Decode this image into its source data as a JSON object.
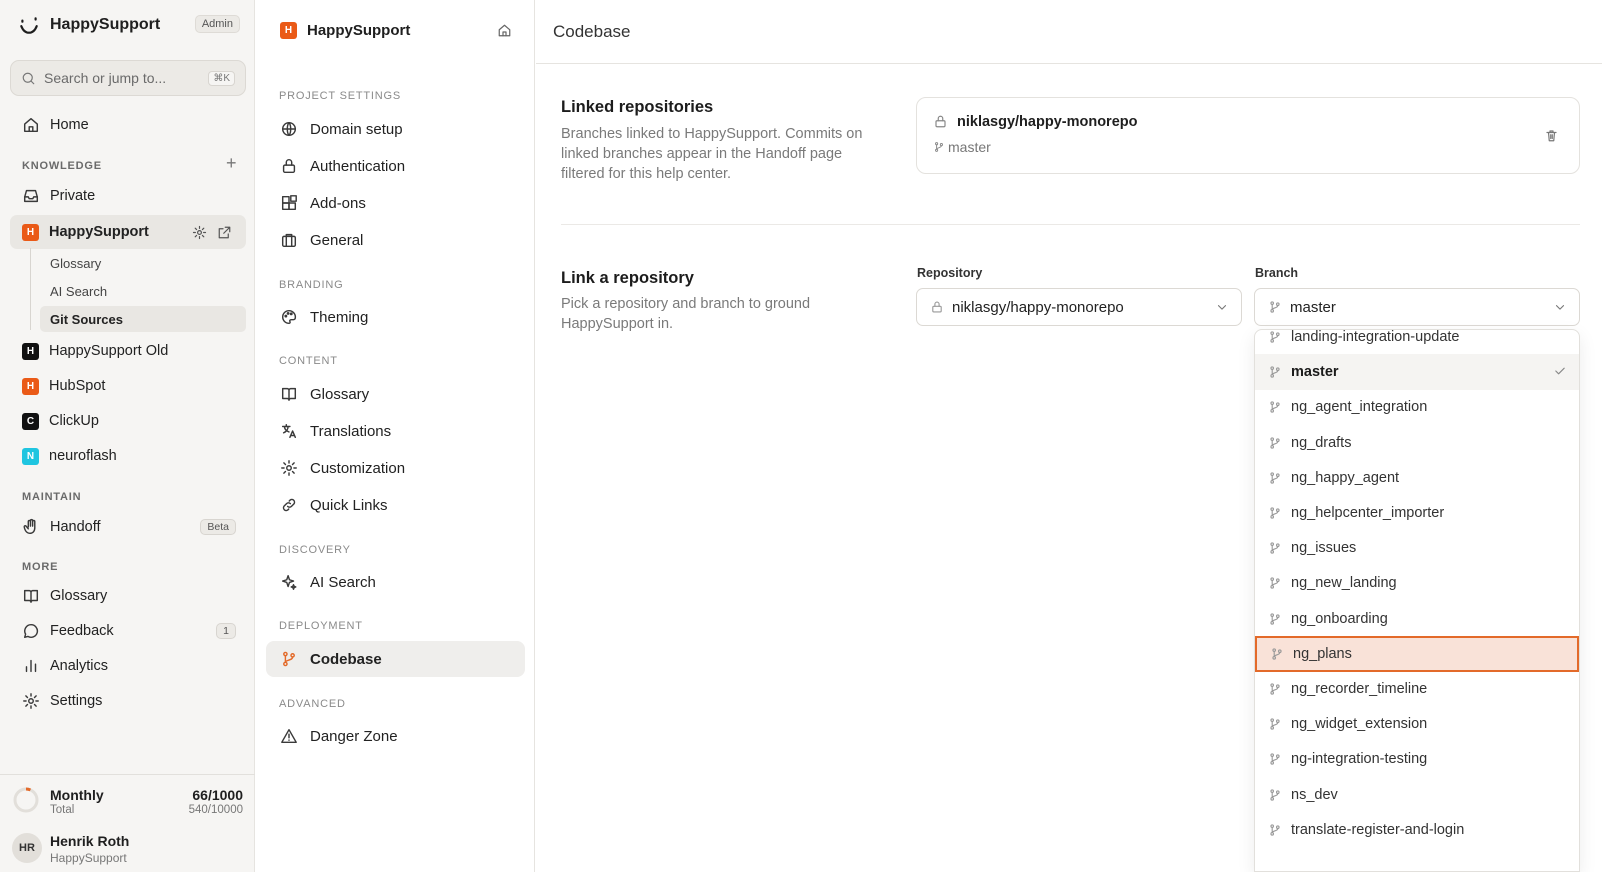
{
  "sidebar": {
    "brand": "HappySupport",
    "role_badge": "Admin",
    "search_placeholder": "Search or jump to...",
    "search_shortcut": "⌘K",
    "home": "Home",
    "knowledge_section": "KNOWLEDGE",
    "private": "Private",
    "active_project": {
      "initial": "H",
      "name": "HappySupport"
    },
    "subitems": [
      "Glossary",
      "AI Search",
      "Git Sources"
    ],
    "projects": [
      {
        "initial": "H",
        "name": "HappySupport Old",
        "color": "#111111"
      },
      {
        "initial": "H",
        "name": "HubSpot",
        "color": "#ea5a17"
      },
      {
        "initial": "C",
        "name": "ClickUp",
        "color": "#111111"
      },
      {
        "initial": "N",
        "name": "neuroflash",
        "color": "#1fc5e0"
      }
    ],
    "maintain_section": "MAINTAIN",
    "handoff": "Handoff",
    "handoff_badge": "Beta",
    "more_section": "MORE",
    "glossary": "Glossary",
    "feedback": "Feedback",
    "feedback_count": "1",
    "analytics": "Analytics",
    "settings": "Settings",
    "usage": {
      "label": "Monthly",
      "sublabel": "Total",
      "value": "66/1000",
      "total": "540/10000",
      "fraction": 0.066
    },
    "user": {
      "initials": "HR",
      "name": "Henrik Roth",
      "org": "HappySupport"
    }
  },
  "settings_nav": {
    "project_initial": "H",
    "project_name": "HappySupport",
    "sections": {
      "project_settings": "PROJECT SETTINGS",
      "branding": "BRANDING",
      "content": "CONTENT",
      "discovery": "DISCOVERY",
      "deployment": "DEPLOYMENT",
      "advanced": "ADVANCED"
    },
    "items": {
      "domain_setup": "Domain setup",
      "authentication": "Authentication",
      "addons": "Add-ons",
      "general": "General",
      "theming": "Theming",
      "glossary": "Glossary",
      "translations": "Translations",
      "customization": "Customization",
      "quick_links": "Quick Links",
      "ai_search": "AI Search",
      "codebase": "Codebase",
      "danger_zone": "Danger Zone"
    }
  },
  "main": {
    "title": "Codebase",
    "linked": {
      "heading": "Linked repositories",
      "description": "Branches linked to HappySupport. Commits on linked branches appear in the Handoff page filtered for this help center.",
      "repo": "niklasgy/happy-monorepo",
      "branch": "master"
    },
    "link": {
      "heading": "Link a repository",
      "description": "Pick a repository and branch to ground HappySupport in.",
      "repository_label": "Repository",
      "repository_value": "niklasgy/happy-monorepo",
      "branch_label": "Branch",
      "branch_value": "master"
    },
    "branch_options": [
      "landing-integration-update",
      "master",
      "ng_agent_integration",
      "ng_drafts",
      "ng_happy_agent",
      "ng_helpcenter_importer",
      "ng_issues",
      "ng_new_landing",
      "ng_onboarding",
      "ng_plans",
      "ng_recorder_timeline",
      "ng_widget_extension",
      "ng-integration-testing",
      "ns_dev",
      "translate-register-and-login"
    ],
    "selected_option": "master",
    "highlighted_option": "ng_plans"
  },
  "colors": {
    "accent": "#e36a2a",
    "highlight_bg": "#f9e2d8"
  }
}
